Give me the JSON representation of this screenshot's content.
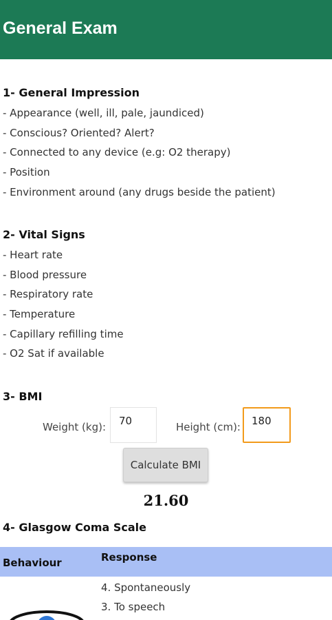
{
  "header": {
    "title": "General Exam"
  },
  "sections": {
    "general_impression": {
      "title": "1- General Impression",
      "items": [
        "- Appearance (well, ill, pale, jaundiced)",
        "- Conscious? Oriented? Alert?",
        "- Connected to any device (e.g: O2 therapy)",
        "- Position",
        "- Environment around (any drugs beside the patient)"
      ]
    },
    "vital_signs": {
      "title": "2- Vital Signs",
      "items": [
        "- Heart rate",
        "- Blood pressure",
        "- Respiratory rate",
        "- Temperature",
        "- Capillary refilling time",
        "- O2 Sat if available"
      ]
    },
    "bmi": {
      "title": "3- BMI",
      "weight_label": "Weight (kg):",
      "weight_value": "70",
      "height_label": "Height (cm):",
      "height_value": "180",
      "button_label": "Calculate BMI",
      "result": "21.60"
    },
    "gcs": {
      "title": "4- Glasgow Coma Scale",
      "columns": [
        "Behaviour",
        "Response"
      ],
      "responses": [
        "4. Spontaneously",
        "3. To speech"
      ]
    }
  },
  "colors": {
    "header_bg": "#1c7a55",
    "table_header_bg": "#a9bff5",
    "focus_border": "#f29a1a"
  }
}
